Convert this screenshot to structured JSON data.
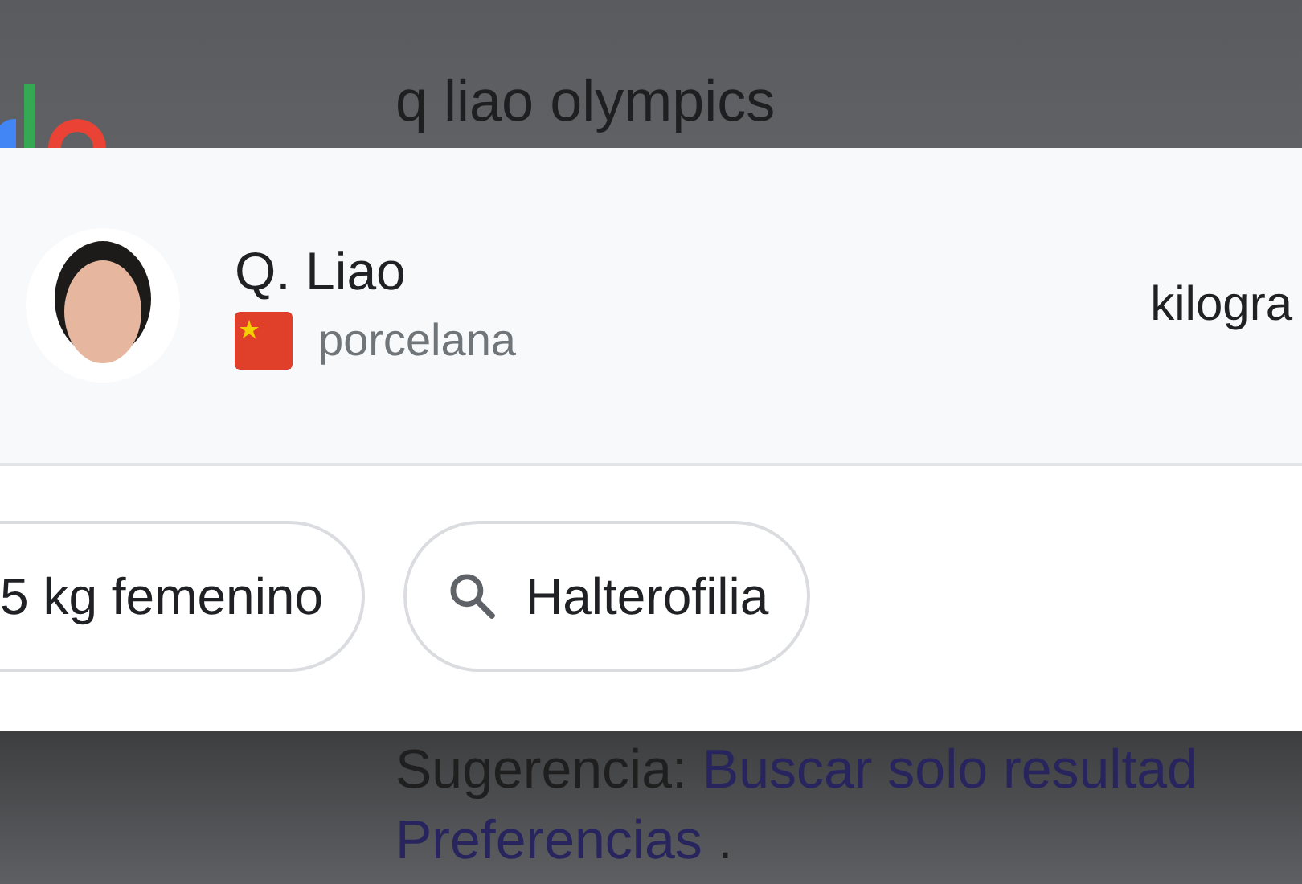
{
  "search": {
    "query": "q liao olympics"
  },
  "entity": {
    "name": "Q. Liao",
    "country": "porcelana",
    "right_text": "kilogra"
  },
  "chips": [
    {
      "label": "5 kg femenino",
      "kind": "plain"
    },
    {
      "label": "Halterofilia",
      "kind": "search"
    }
  ],
  "suggestion": {
    "label": "Sugerencia:",
    "link": "Buscar solo resultad",
    "link2": "Preferencias",
    "tail": "."
  }
}
